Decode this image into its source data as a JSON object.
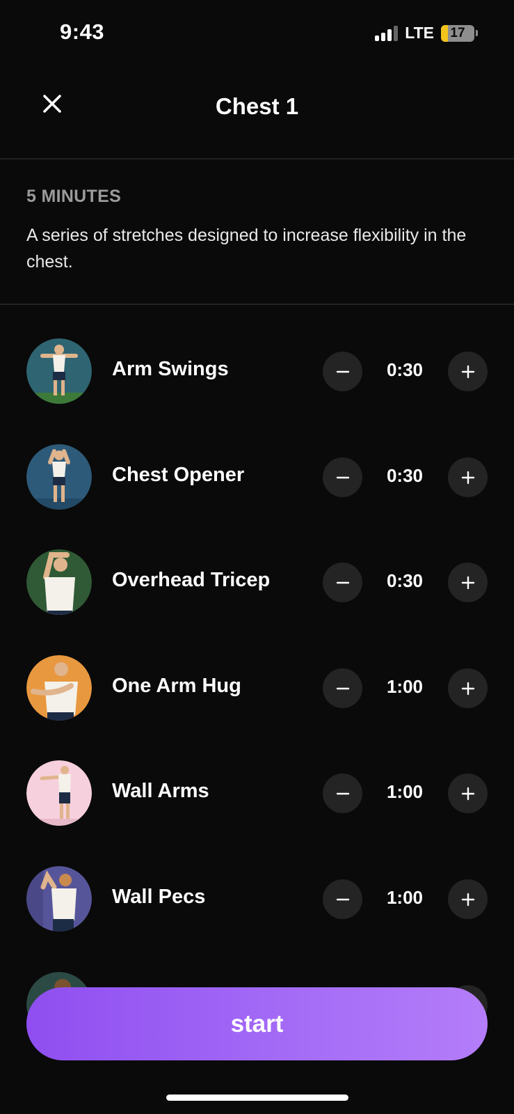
{
  "status_bar": {
    "time": "9:43",
    "network": "LTE",
    "battery": "17"
  },
  "header": {
    "title": "Chest 1"
  },
  "summary": {
    "duration": "5 MINUTES",
    "description": "A series of stretches designed to increase flexibility in the chest."
  },
  "exercises": [
    {
      "name": "Arm Swings",
      "time": "0:30",
      "bg": "#2f6472"
    },
    {
      "name": "Chest Opener",
      "time": "0:30",
      "bg": "#2e5a7a"
    },
    {
      "name": "Overhead Tricep",
      "time": "0:30",
      "bg": "#2f5a35"
    },
    {
      "name": "One Arm Hug",
      "time": "1:00",
      "bg": "#e8983f"
    },
    {
      "name": "Wall Arms",
      "time": "1:00",
      "bg": "#f7d0dd"
    },
    {
      "name": "Wall Pecs",
      "time": "1:00",
      "bg": "#57559a"
    }
  ],
  "start_button": {
    "label": "start"
  },
  "colors": {
    "accent": "#a36af6",
    "background": "#0a0a0a",
    "control_bg": "#242424"
  }
}
